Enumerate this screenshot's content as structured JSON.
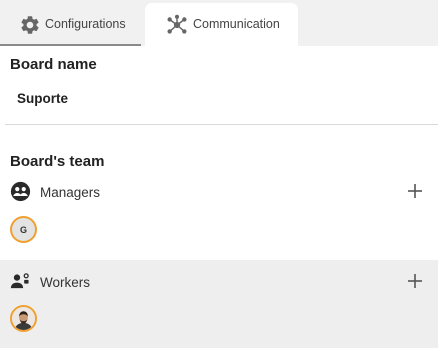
{
  "tabs": {
    "configurations": {
      "label": "Configurations",
      "icon": "gear-icon"
    },
    "communication": {
      "label": "Communication",
      "icon": "network-icon"
    }
  },
  "board_name": {
    "title": "Board name",
    "value": "Suporte"
  },
  "team": {
    "title": "Board's team",
    "managers": {
      "label": "Managers",
      "icon": "managers-icon",
      "members": [
        {
          "initial": "G"
        }
      ]
    },
    "workers": {
      "label": "Workers",
      "icon": "workers-icon",
      "members": [
        {
          "avatar": "photo-avatar"
        }
      ]
    }
  },
  "colors": {
    "avatar_border": "#f0a030",
    "selected_row_bg": "#eeeeee",
    "tab_bar_bg": "#f1f1f1"
  }
}
